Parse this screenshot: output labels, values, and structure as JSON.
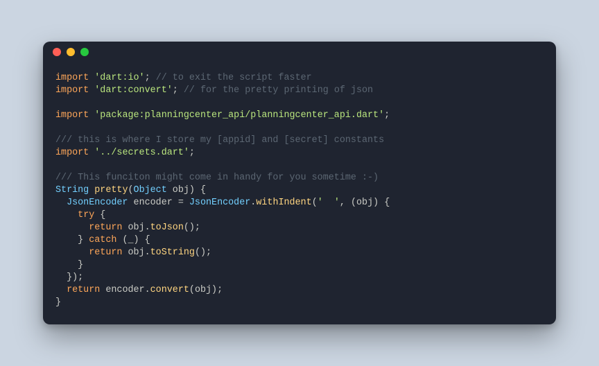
{
  "code": {
    "l1_kw": "import",
    "l1_str": "'dart:io'",
    "l1_semi": ";",
    "l1_cmt": "// to exit the script faster",
    "l2_kw": "import",
    "l2_str": "'dart:convert'",
    "l2_semi": ";",
    "l2_cmt": "// for the pretty printing of json",
    "l4_kw": "import",
    "l4_str": "'package:planningcenter_api/planningcenter_api.dart'",
    "l4_semi": ";",
    "l6_cmt": "/// this is where I store my [appid] and [secret] constants",
    "l7_kw": "import",
    "l7_str": "'../secrets.dart'",
    "l7_semi": ";",
    "l9_cmt": "/// This funciton might come in handy for you sometime :-)",
    "l10_type": "String",
    "l10_fn": "pretty",
    "l10_p1": "(",
    "l10_ptype": "Object",
    "l10_pid": "obj",
    "l10_p2": ") {",
    "l11_indent": "  ",
    "l11_type1": "JsonEncoder",
    "l11_id": "encoder",
    "l11_eq": " = ",
    "l11_type2": "JsonEncoder",
    "l11_dot": ".",
    "l11_fn": "withIndent",
    "l11_p1": "(",
    "l11_str": "'  '",
    "l11_comma": ", (",
    "l11_pid": "obj",
    "l11_p2": ") {",
    "l12_indent": "    ",
    "l12_kw": "try",
    "l12_p": " {",
    "l13_indent": "      ",
    "l13_kw": "return",
    "l13_id": "obj",
    "l13_dot": ".",
    "l13_fn": "toJson",
    "l13_p": "();",
    "l14_indent": "    ",
    "l14_p1": "} ",
    "l14_kw": "catch",
    "l14_p2": " (_) {",
    "l15_indent": "      ",
    "l15_kw": "return",
    "l15_id": "obj",
    "l15_dot": ".",
    "l15_fn": "toString",
    "l15_p": "();",
    "l16_indent": "    ",
    "l16_p": "}",
    "l17_indent": "  ",
    "l17_p": "});",
    "l18_indent": "  ",
    "l18_kw": "return",
    "l18_id": "encoder",
    "l18_dot": ".",
    "l18_fn": "convert",
    "l18_p1": "(",
    "l18_arg": "obj",
    "l18_p2": ");",
    "l19_p": "}"
  }
}
